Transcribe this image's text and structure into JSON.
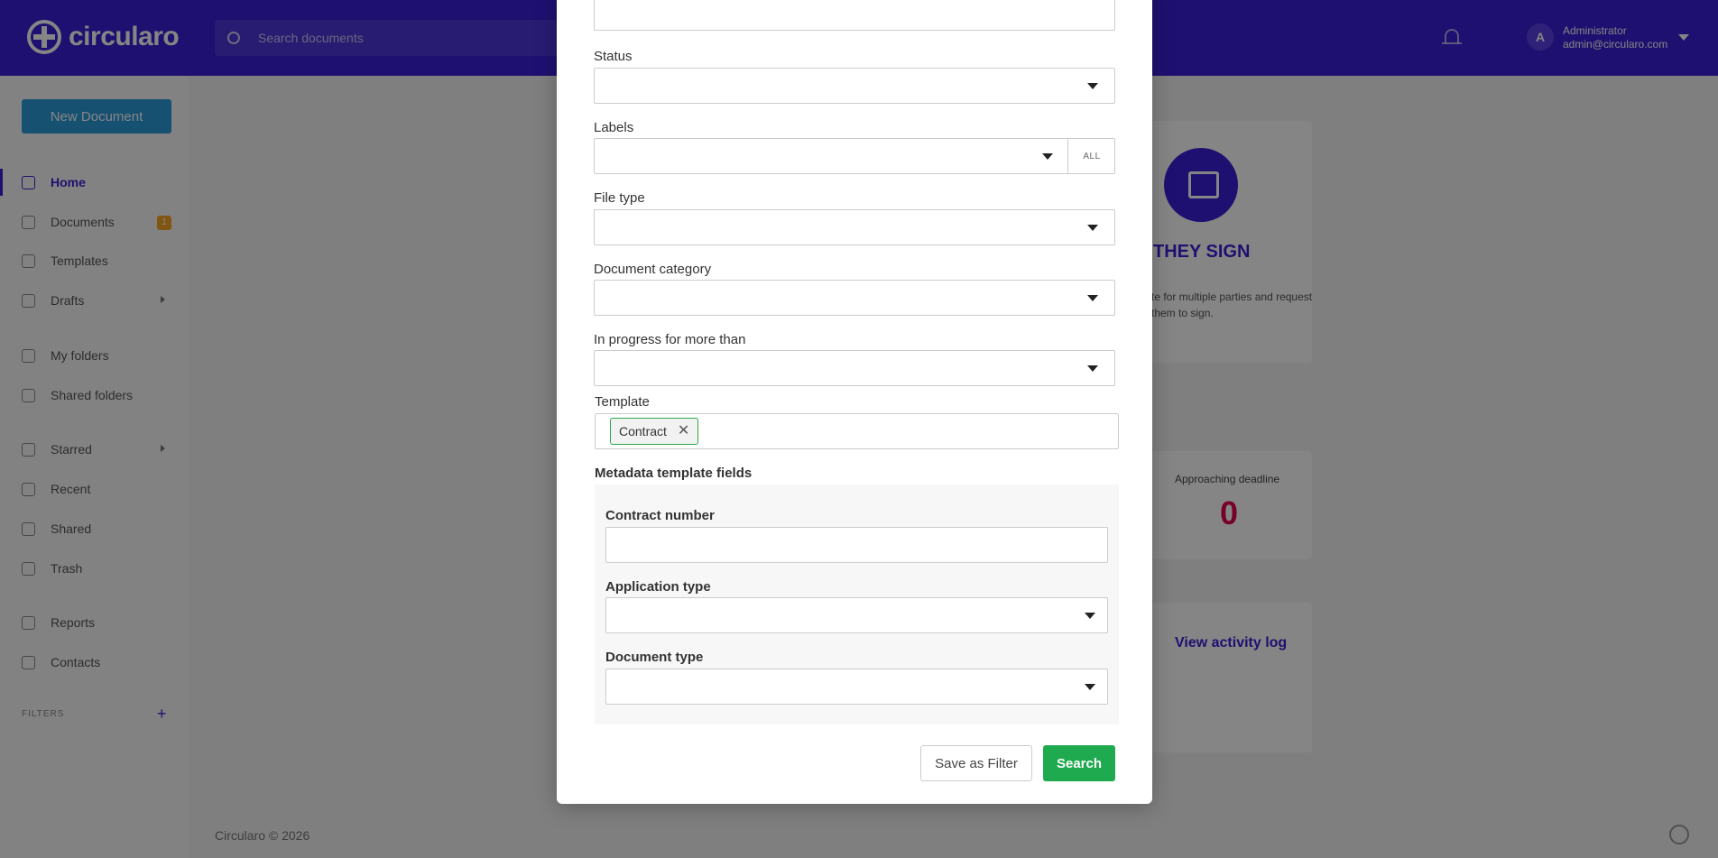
{
  "app": {
    "logo_text": "circularo",
    "search_placeholder": "Search documents"
  },
  "user": {
    "avatar_initial": "A",
    "name": "Administrator",
    "email": "admin@circularo.com"
  },
  "sidebar": {
    "new_document_label": "New Document",
    "items": [
      {
        "label": "Home"
      },
      {
        "label": "Documents",
        "badge": "1"
      },
      {
        "label": "Templates"
      },
      {
        "label": "Drafts"
      },
      {
        "label": "My folders"
      },
      {
        "label": "Shared folders"
      },
      {
        "label": "Starred"
      },
      {
        "label": "Recent"
      },
      {
        "label": "Shared"
      },
      {
        "label": "Trash"
      },
      {
        "label": "Reports"
      },
      {
        "label": "Contacts"
      }
    ],
    "filters_label": "FILTERS",
    "filters_add": "+"
  },
  "background": {
    "sign_title": "THEY SIGN",
    "sign_desc": "te for multiple parties and request them to sign.",
    "deadline_label": "Approaching deadline",
    "deadline_value": "0",
    "activity_link": "View activity log",
    "footer": "Circularo © 2026"
  },
  "modal": {
    "status_label": "Status",
    "labels_label": "Labels",
    "labels_all": "ALL",
    "filetype_label": "File type",
    "category_label": "Document category",
    "inprogress_label": "In progress for more than",
    "template_label": "Template",
    "template_tag": "Contract",
    "template_tag_remove": "✕",
    "metadata_label": "Metadata template fields",
    "contract_number_label": "Contract number",
    "application_type_label": "Application type",
    "document_type_label": "Document type",
    "save_filter_label": "Save as Filter",
    "search_label": "Search"
  },
  "colors": {
    "brand": "#3a1fd6",
    "accent_green": "#1faa50",
    "badge": "#f5a623",
    "deadline": "#e3004f"
  }
}
